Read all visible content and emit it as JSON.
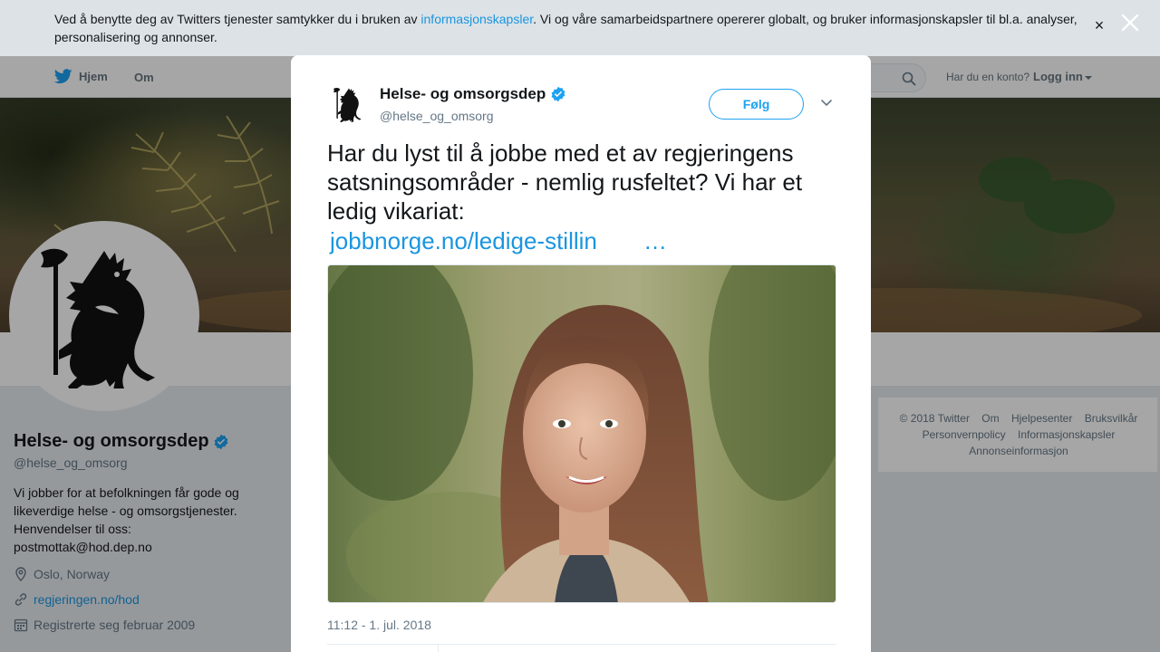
{
  "cookie_banner": {
    "text_before": "Ved å benytte deg av Twitters tjenester samtykker du i bruken av ",
    "link": "informasjonskapsler",
    "text_after": ". Vi og våre samarbeidspartnere opererer globalt, og bruker informasjonskapsler til bl.a. analyser, personalisering og annonser.",
    "close_glyph": "×"
  },
  "nav": {
    "home": "Hjem",
    "about": "Om",
    "account_prompt": "Har du en konto?",
    "login": "Logg inn"
  },
  "profile": {
    "name": "Helse- og omsorgsdep",
    "handle": "@helse_og_omsorg",
    "bio_lines": [
      "Vi jobber for at befolkningen får gode og",
      "likeverdige helse - og omsorgstjenester.",
      "Henvendelser til oss:",
      "postmottak@hod.dep.no"
    ],
    "location": "Oslo, Norway",
    "website": "regjeringen.no/hod",
    "joined": "Registrerte seg februar 2009"
  },
  "footer": {
    "row1": [
      "© 2018 Twitter",
      "Om",
      "Hjelpesenter",
      "Bruksvilkår"
    ],
    "row2": [
      "Personvernpolicy",
      "Informasjonskapsler"
    ],
    "row3": [
      "Annonseinformasjon"
    ]
  },
  "tweet": {
    "author_name": "Helse- og omsorgsdep",
    "author_handle": "@helse_og_omsorg",
    "follow_label": "Følg",
    "text_lines": [
      "Har du lyst til å jobbe med et av regjeringens",
      "satsningsområder - nemlig rusfeltet? Vi har et",
      "ledig vikariat:"
    ],
    "link_text": "jobbnorge.no/ledige-stillin",
    "link_ellipsis": "…",
    "timestamp": "11:12 - 1. jul. 2018"
  },
  "colors": {
    "twitter_blue": "#1da1f2",
    "link_blue": "#1b95e0",
    "text_dark": "#14171a",
    "text_gray": "#657786"
  },
  "icons": {
    "home": "twitter-bird-icon",
    "search": "search-icon",
    "verified": "verified-badge-icon",
    "location": "location-pin-icon",
    "link": "link-icon",
    "calendar": "calendar-icon",
    "caret": "chevron-down-icon",
    "close": "close-icon"
  }
}
